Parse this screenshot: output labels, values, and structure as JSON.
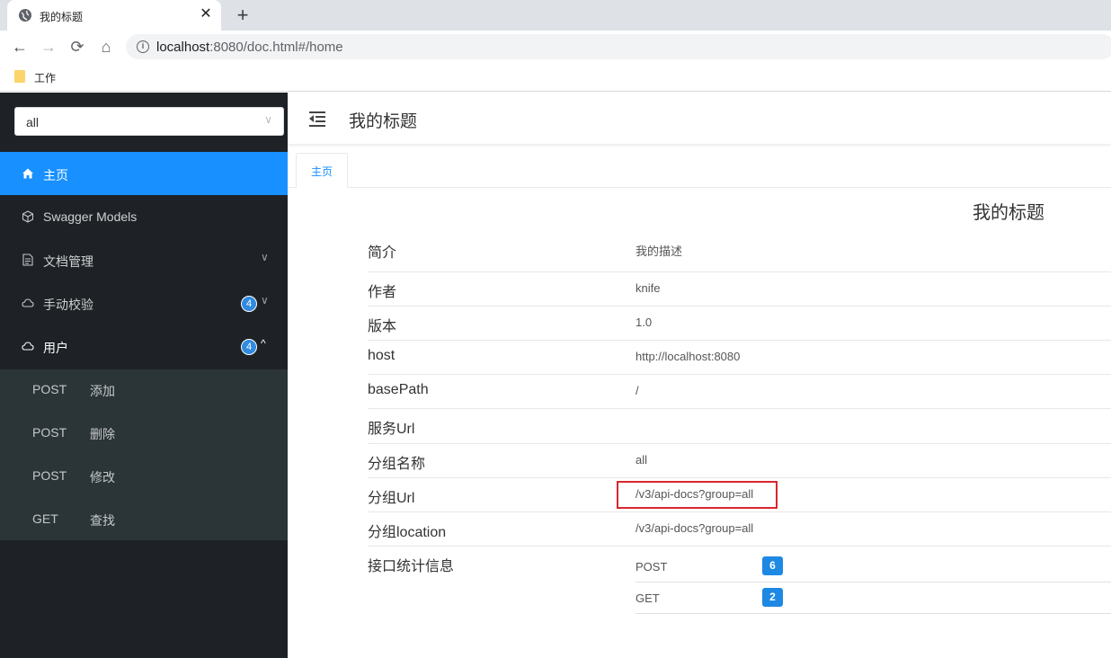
{
  "browser": {
    "tab_title": "我的标题",
    "close_glyph": "✕",
    "new_tab_glyph": "+",
    "back_glyph": "←",
    "forward_glyph": "→",
    "reload_glyph": "⟳",
    "home_glyph": "⌂",
    "info_glyph": "i",
    "url_host": "localhost",
    "url_rest": ":8080/doc.html#/home",
    "bookmark": "工作"
  },
  "sidebar": {
    "group_select": {
      "value": "all",
      "chevron": "∨"
    },
    "menu": [
      {
        "label": "主页",
        "icon": "home-icon",
        "state": "active"
      },
      {
        "label": "Swagger Models",
        "icon": "cube-icon"
      },
      {
        "label": "文档管理",
        "icon": "document-icon",
        "chevron": "∨"
      },
      {
        "label": "手动校验",
        "icon": "cloud-icon",
        "badge": "4",
        "chevron": "∨"
      },
      {
        "label": "用户",
        "icon": "cloud-icon",
        "badge": "4",
        "chevron": "^",
        "state": "open"
      }
    ],
    "submenu": [
      {
        "method": "POST",
        "name": "添加"
      },
      {
        "method": "POST",
        "name": "删除"
      },
      {
        "method": "POST",
        "name": "修改"
      },
      {
        "method": "GET",
        "name": "查找"
      }
    ]
  },
  "header": {
    "title": "我的标题",
    "menu_icon": "menu-fold-icon"
  },
  "tabs": [
    {
      "label": "主页"
    }
  ],
  "doc": {
    "heading": "我的标题",
    "rows": [
      {
        "key": "简介",
        "value": "我的描述"
      },
      {
        "key": "作者",
        "value": "knife"
      },
      {
        "key": "版本",
        "value": "1.0"
      },
      {
        "key": "host",
        "value": "http://localhost:8080"
      },
      {
        "key": "basePath",
        "value": "/"
      },
      {
        "key": "服务Url",
        "value": ""
      },
      {
        "key": "分组名称",
        "value": "all"
      },
      {
        "key": "分组Url",
        "value": "/v3/api-docs?group=all",
        "highlighted": true
      },
      {
        "key": "分组location",
        "value": "/v3/api-docs?group=all"
      },
      {
        "key": "接口统计信息",
        "value": ""
      }
    ],
    "stats": [
      {
        "method": "POST",
        "count": "6"
      },
      {
        "method": "GET",
        "count": "2"
      }
    ]
  },
  "colors": {
    "sidebar_bg": "#1e2226",
    "submenu_bg": "#2b3538",
    "active": "#1890ff",
    "badge": "#1e88e5",
    "highlight_border": "#d9272e"
  }
}
